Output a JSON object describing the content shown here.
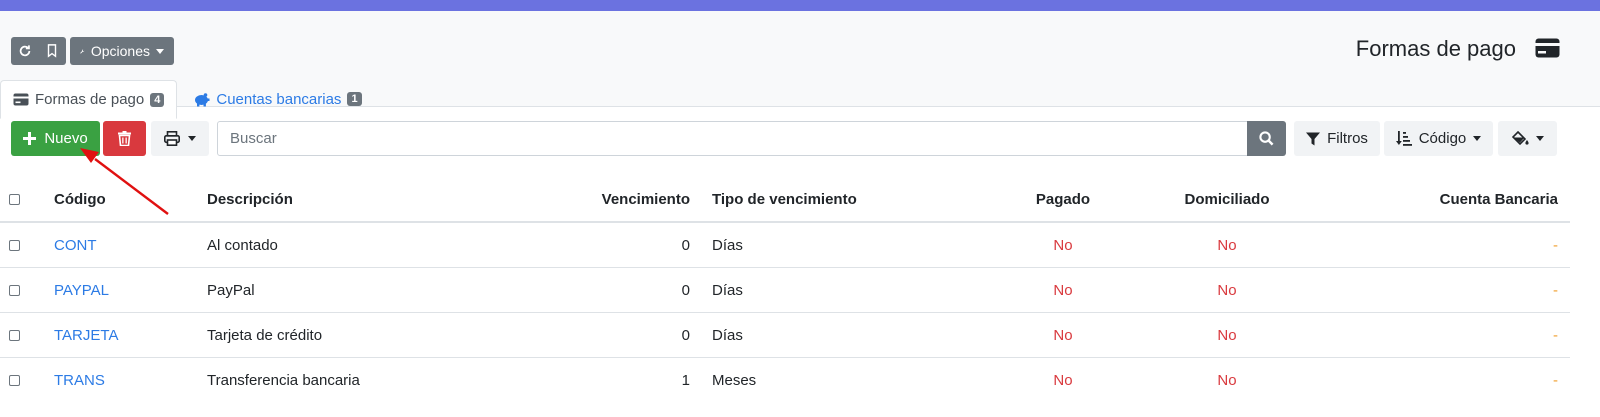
{
  "header": {
    "options_label": "Opciones",
    "page_title": "Formas de pago"
  },
  "tabs": [
    {
      "label": "Formas de pago",
      "count": "4"
    },
    {
      "label": "Cuentas bancarias",
      "count": "1"
    }
  ],
  "toolbar": {
    "new_label": "Nuevo",
    "search_placeholder": "Buscar",
    "filters_label": "Filtros",
    "sort_label": "Código"
  },
  "table": {
    "columns": [
      "Código",
      "Descripción",
      "Vencimiento",
      "Tipo de vencimiento",
      "Pagado",
      "Domiciliado",
      "Cuenta Bancaria"
    ],
    "rows": [
      {
        "code": "CONT",
        "description": "Al contado",
        "due": "0",
        "due_type": "Días",
        "paid": "No",
        "direct_debit": "No",
        "bank_account": "-"
      },
      {
        "code": "PAYPAL",
        "description": "PayPal",
        "due": "0",
        "due_type": "Días",
        "paid": "No",
        "direct_debit": "No",
        "bank_account": "-"
      },
      {
        "code": "TARJETA",
        "description": "Tarjeta de crédito",
        "due": "0",
        "due_type": "Días",
        "paid": "No",
        "direct_debit": "No",
        "bank_account": "-"
      },
      {
        "code": "TRANS",
        "description": "Transferencia bancaria",
        "due": "1",
        "due_type": "Meses",
        "paid": "No",
        "direct_debit": "No",
        "bank_account": "-"
      }
    ]
  },
  "colors": {
    "top_bar": "#6b72e0",
    "success": "#3aa142",
    "danger": "#d9393e",
    "link": "#2c7be5",
    "secondary": "#6c757d"
  },
  "icons": [
    "refresh-icon",
    "bookmark-icon",
    "wrench-icon",
    "credit-card-icon",
    "piggy-bank-icon",
    "plus-icon",
    "trash-icon",
    "print-icon",
    "search-icon",
    "filter-icon",
    "sort-icon",
    "paint-bucket-icon"
  ]
}
